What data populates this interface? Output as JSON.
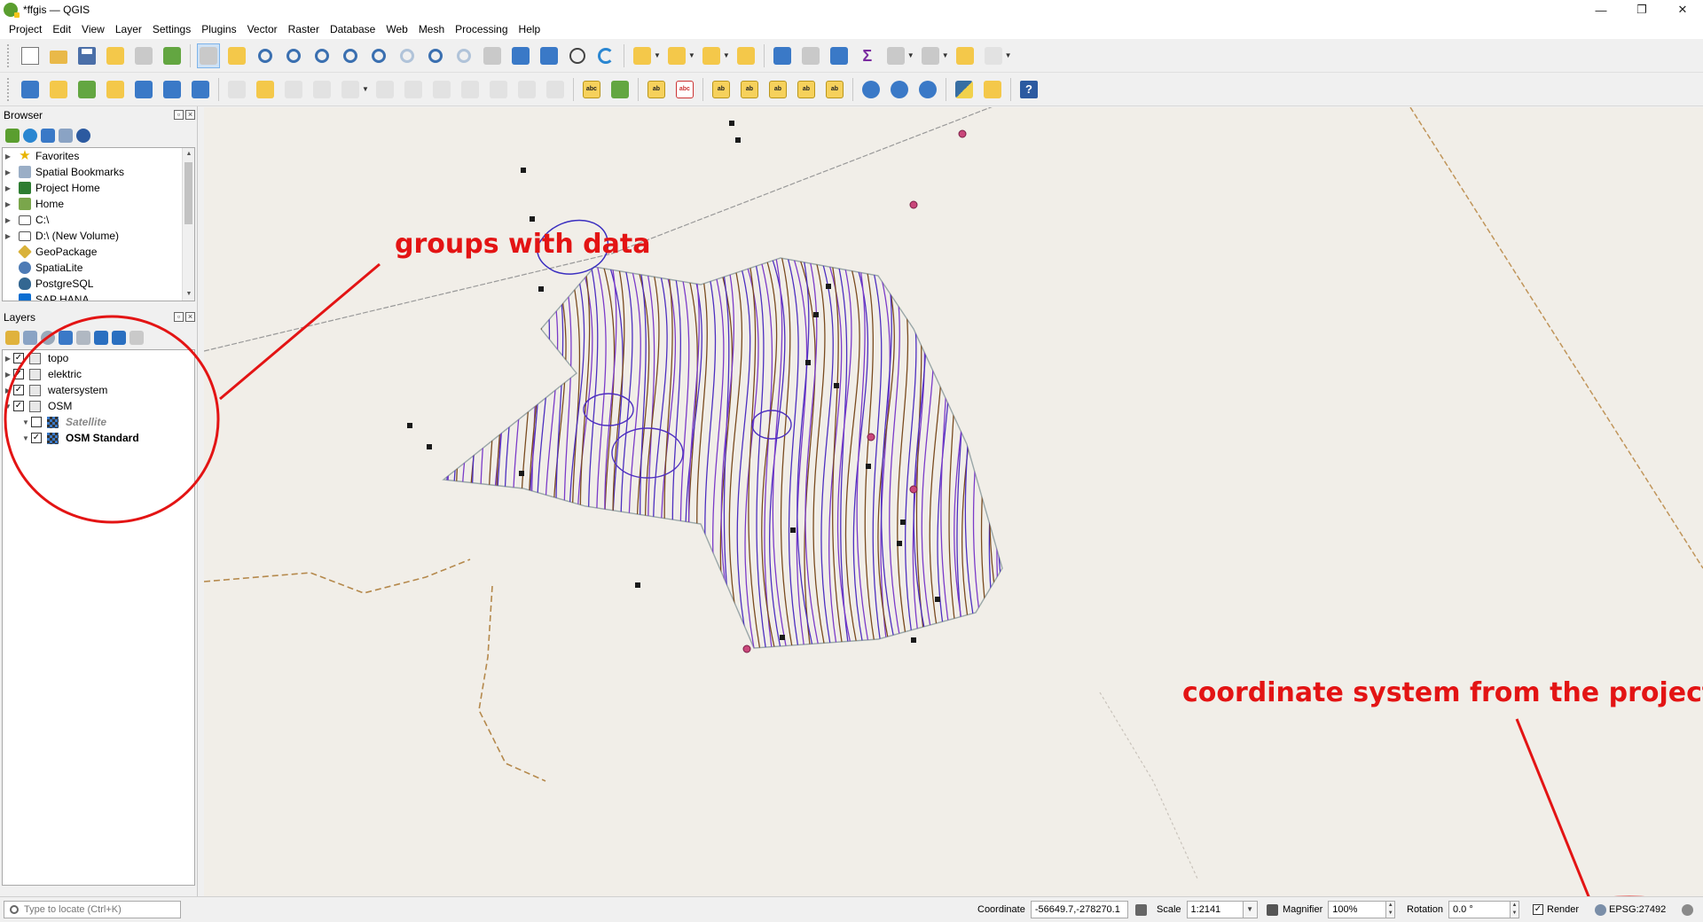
{
  "window": {
    "title": "*ffgis — QGIS",
    "controls": {
      "minimize": "—",
      "restore": "❐",
      "close": "✕"
    }
  },
  "menu": [
    "Project",
    "Edit",
    "View",
    "Layer",
    "Settings",
    "Plugins",
    "Vector",
    "Raster",
    "Database",
    "Web",
    "Mesh",
    "Processing",
    "Help"
  ],
  "browser": {
    "title": "Browser",
    "items": [
      {
        "label": "Favorites",
        "icon": "star-icon"
      },
      {
        "label": "Spatial Bookmarks",
        "icon": "bookmark-icon"
      },
      {
        "label": "Project Home",
        "icon": "project-home-icon"
      },
      {
        "label": "Home",
        "icon": "home-icon"
      },
      {
        "label": "C:\\",
        "icon": "drive-icon"
      },
      {
        "label": "D:\\ (New Volume)",
        "icon": "drive-icon"
      },
      {
        "label": "GeoPackage",
        "icon": "geopackage-icon"
      },
      {
        "label": "SpatiaLite",
        "icon": "spatialite-icon"
      },
      {
        "label": "PostgreSQL",
        "icon": "postgresql-icon"
      },
      {
        "label": "SAP HANA",
        "icon": "sap-hana-icon"
      }
    ]
  },
  "layers": {
    "title": "Layers",
    "items": [
      {
        "label": "topo",
        "checked": true,
        "expanded": false
      },
      {
        "label": "elektric",
        "checked": true,
        "expanded": false
      },
      {
        "label": "watersystem",
        "checked": true,
        "expanded": false
      },
      {
        "label": "OSM",
        "checked": true,
        "expanded": true
      },
      {
        "label": "Satellite",
        "checked": false,
        "child": true
      },
      {
        "label": "OSM Standard",
        "checked": true,
        "child": true
      }
    ],
    "check_mark": "✓"
  },
  "annotations": {
    "groups": "groups with data",
    "crs": "coordinate system from the project",
    "color": "#e31414"
  },
  "statusbar": {
    "locator_placeholder": "Type to locate (Ctrl+K)",
    "coordinate_label": "Coordinate",
    "coordinate_value": "-56649.7,-278270.1",
    "scale_label": "Scale",
    "scale_value": "1:2141",
    "magnifier_label": "Magnifier",
    "magnifier_value": "100%",
    "rotation_label": "Rotation",
    "rotation_value": "0.0 °",
    "render_label": "Render",
    "crs_value": "EPSG:27492"
  }
}
